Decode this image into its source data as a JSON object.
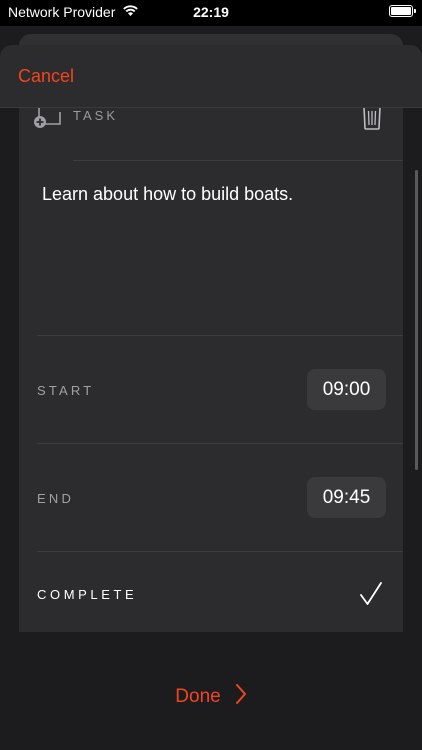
{
  "status_bar": {
    "carrier": "Network Provider",
    "time": "22:19",
    "wifi_icon": "wifi-icon",
    "battery_icon": "battery-icon"
  },
  "nav": {
    "cancel_label": "Cancel"
  },
  "task": {
    "header_label": "TASK",
    "add_icon": "add-task-icon",
    "delete_icon": "trash-icon",
    "text": "Learn about how to build boats."
  },
  "start": {
    "label": "START",
    "time": "09:00"
  },
  "end": {
    "label": "END",
    "time": "09:45"
  },
  "complete": {
    "label": "COMPLETE",
    "checked": true,
    "icon": "checkmark-icon"
  },
  "footer": {
    "done_label": "Done",
    "done_icon": "chevron-right-icon"
  },
  "colors": {
    "accent": "#f2451e",
    "background": "#1c1c1e",
    "card": "#2c2c2e",
    "pill": "#3a3a3c"
  }
}
